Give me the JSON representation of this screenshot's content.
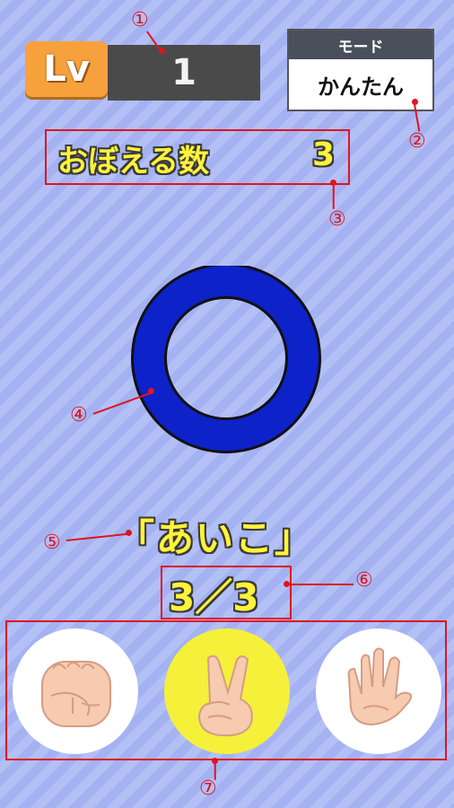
{
  "level": {
    "label": "Lv",
    "value": "1"
  },
  "mode": {
    "title": "モード",
    "value": "かんたん"
  },
  "memory": {
    "label": "おぼえる数",
    "value": "3"
  },
  "result": {
    "text": "「あいこ」",
    "progress": "3／3"
  },
  "callouts": [
    "①",
    "②",
    "③",
    "④",
    "⑤",
    "⑥",
    "⑦"
  ],
  "hands": [
    {
      "name": "rock",
      "selected": false
    },
    {
      "name": "scissors",
      "selected": true
    },
    {
      "name": "paper",
      "selected": false
    }
  ],
  "colors": {
    "accent": "#f7a13c",
    "ring": "#0d22c8",
    "selected": "#f5f03a",
    "callout": "#e0141e"
  }
}
